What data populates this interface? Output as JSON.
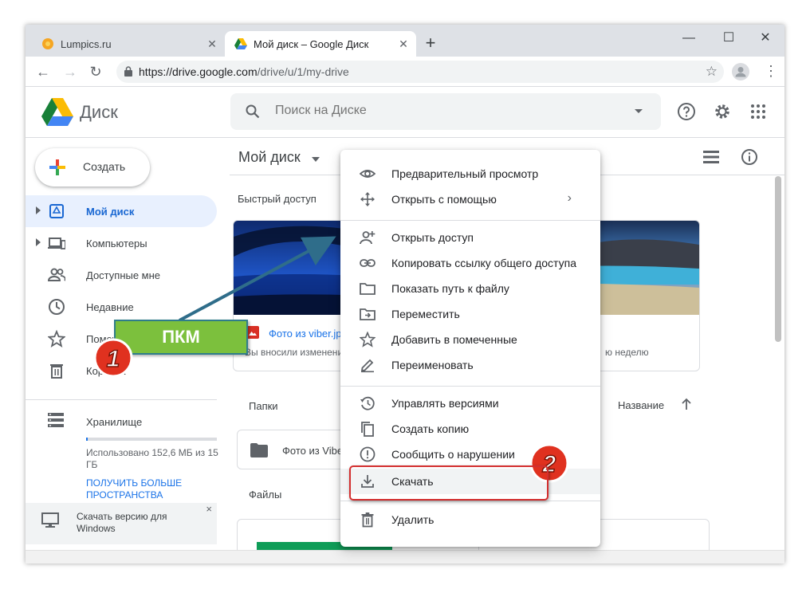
{
  "browser": {
    "tabs": [
      {
        "label": "Lumpics.ru"
      },
      {
        "label": "Мой диск – Google Диск"
      }
    ],
    "new_tab_label": "+",
    "window_controls": {
      "minimize": "—",
      "maximize": "☐",
      "close": "✕"
    },
    "url_host": "https://drive.google.com",
    "url_path": "/drive/u/1/my-drive"
  },
  "header": {
    "app_title": "Диск",
    "search_placeholder": "Поиск на Диске"
  },
  "sidebar": {
    "new_button": "Создать",
    "items": [
      {
        "label": "Мой диск",
        "icon": "my-drive-icon"
      },
      {
        "label": "Компьютеры",
        "icon": "computers-icon"
      },
      {
        "label": "Доступные мне",
        "icon": "shared-icon"
      },
      {
        "label": "Недавние",
        "icon": "clock-icon"
      },
      {
        "label": "Помеченные",
        "icon": "star-icon"
      },
      {
        "label": "Корзина",
        "icon": "trash-icon"
      }
    ],
    "storage": {
      "label": "Хранилище",
      "used_text": "Использовано 152,6 МБ из 15 ГБ",
      "used_fraction": 0.01,
      "upgrade_link": "ПОЛУЧИТЬ БОЛЬШЕ ПРОСТРАНСТВА"
    },
    "download_banner": {
      "text": "Скачать версию для Windows",
      "close": "×"
    }
  },
  "main": {
    "breadcrumb": "Мой диск",
    "quick_access_header": "Быстрый доступ",
    "quick_cards": [
      {
        "name": "Фото из viber.jpg",
        "subtitle": "Вы вносили изменения"
      },
      {
        "name": "",
        "subtitle": "ю неделю"
      }
    ],
    "folders_header": "Папки",
    "sort_label": "Название",
    "folder_name": "Фото из Viber",
    "files_header": "Файлы"
  },
  "context_menu": {
    "items": [
      {
        "label": "Предварительный просмотр",
        "icon": "eye-icon"
      },
      {
        "label": "Открыть с помощью",
        "icon": "open-with-icon",
        "submenu": "›"
      },
      {
        "label": "Открыть доступ",
        "icon": "person-add-icon"
      },
      {
        "label": "Копировать ссылку общего доступа",
        "icon": "link-icon"
      },
      {
        "label": "Показать путь к файлу",
        "icon": "folder-icon"
      },
      {
        "label": "Переместить",
        "icon": "move-to-icon"
      },
      {
        "label": "Добавить в помеченные",
        "icon": "star-icon"
      },
      {
        "label": "Переименовать",
        "icon": "pencil-icon"
      },
      {
        "label": "Управлять версиями",
        "icon": "history-icon"
      },
      {
        "label": "Создать копию",
        "icon": "copy-icon"
      },
      {
        "label": "Сообщить о нарушении",
        "icon": "report-icon"
      },
      {
        "label": "Скачать",
        "icon": "download-icon"
      },
      {
        "label": "Удалить",
        "icon": "trash-icon"
      }
    ]
  },
  "annotations": {
    "callout": "ПКМ",
    "step1": "1",
    "step2": "2"
  },
  "colors": {
    "accent": "#1a73e8",
    "selected_nav_bg": "#e8f0fe",
    "callout_green": "#7cc03d",
    "badge_red": "#e0311f",
    "highlight_red": "#d32f2f"
  }
}
